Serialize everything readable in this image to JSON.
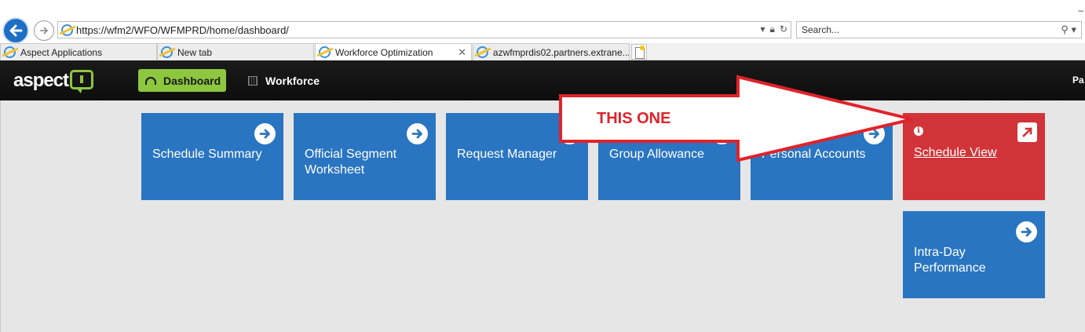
{
  "browser": {
    "url": "https://wfm2/WFO/WFMPRD/home/dashboard/",
    "search_placeholder": "Search...",
    "minimize_glyph": "–",
    "tabs": [
      {
        "label": "Aspect Applications"
      },
      {
        "label": "New tab"
      },
      {
        "label": "Workforce Optimization",
        "close": "✕"
      },
      {
        "label": "azwfmprdis02.partners.extrane..."
      }
    ]
  },
  "header": {
    "logo_text": "aspect",
    "nav": {
      "dashboard_label": "Dashboard",
      "workforce_label": "Workforce"
    },
    "user_name": "Pa"
  },
  "tiles": [
    {
      "label": "Schedule Summary",
      "icon": "arrow-right-circle-icon"
    },
    {
      "label": "Official Segment Worksheet",
      "icon": "arrow-right-circle-icon"
    },
    {
      "label": "Request Manager",
      "icon": "arrow-right-circle-icon"
    },
    {
      "label": "Group Allowance",
      "icon": "arrow-right-circle-icon"
    },
    {
      "label": "Personal Accounts",
      "icon": "arrow-right-circle-icon"
    },
    {
      "label": "Schedule View",
      "icon": "external-link-icon",
      "info": "i"
    },
    {
      "label": "Intra-Day Performance",
      "icon": "arrow-right-circle-icon"
    }
  ],
  "annotation": {
    "text": "THIS ONE",
    "color": "#e0232a"
  },
  "colors": {
    "tile_blue": "#2a75c1",
    "tile_red": "#d13438",
    "accent_green": "#8dc63f",
    "header_bg": "#111111"
  }
}
